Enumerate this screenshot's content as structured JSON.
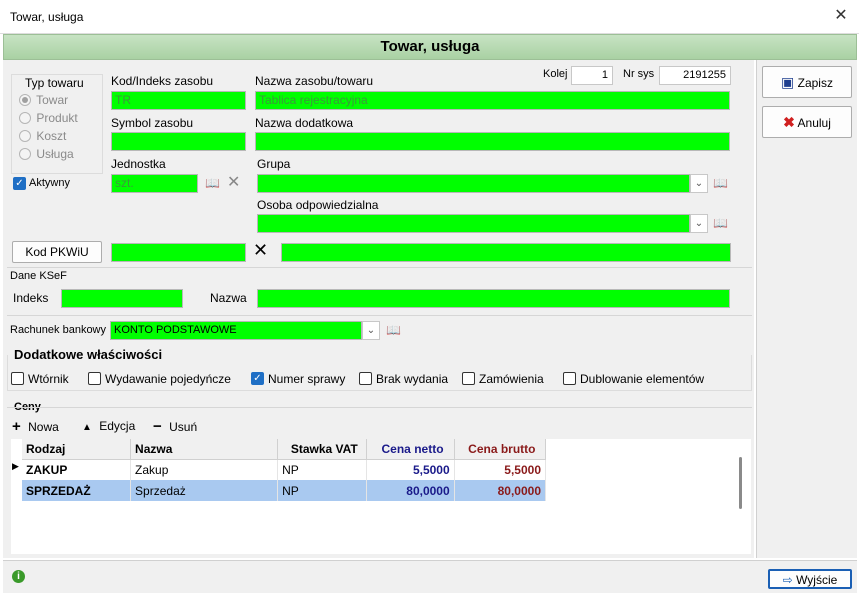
{
  "window": {
    "title": "Towar, usługa",
    "close_glyph": "✕"
  },
  "banner": {
    "title": "Towar, usługa"
  },
  "type_group": {
    "label": "Typ towaru",
    "options": [
      {
        "label": "Towar",
        "selected": true
      },
      {
        "label": "Produkt",
        "selected": false
      },
      {
        "label": "Koszt",
        "selected": false
      },
      {
        "label": "Usługa",
        "selected": false
      }
    ]
  },
  "active": {
    "label": "Aktywny",
    "checked": true
  },
  "fields": {
    "kod_label": "Kod/Indeks zasobu",
    "kod_value": "TR",
    "nazwa_label": "Nazwa zasobu/towaru",
    "nazwa_value": "Tablica rejestracyjna",
    "symbol_label": "Symbol zasobu",
    "symbol_value": "",
    "nazwa_dod_label": "Nazwa dodatkowa",
    "nazwa_dod_value": "",
    "jednostka_label": "Jednostka",
    "jednostka_value": "szt.",
    "grupa_label": "Grupa",
    "grupa_value": "",
    "osoba_label": "Osoba odpowiedzialna",
    "osoba_value": "",
    "kolej_label": "Kolej",
    "kolej_value": "1",
    "nrsys_label": "Nr sys",
    "nrsys_value": "2191255"
  },
  "pkwiu": {
    "button": "Kod PKWiU",
    "code": "",
    "desc": ""
  },
  "ksef": {
    "label": "Dane KSeF",
    "indeks_label": "Indeks",
    "indeks_value": "",
    "nazwa_label": "Nazwa",
    "nazwa_value": ""
  },
  "bank": {
    "label": "Rachunek bankowy",
    "value": "KONTO PODSTAWOWE"
  },
  "extra": {
    "label": "Dodatkowe właściwości",
    "items": [
      {
        "label": "Wtórnik",
        "checked": false
      },
      {
        "label": "Wydawanie pojedyńcze",
        "checked": false
      },
      {
        "label": "Numer sprawy",
        "checked": true
      },
      {
        "label": "Brak wydania",
        "checked": false
      },
      {
        "label": "Zamówienia",
        "checked": false
      },
      {
        "label": "Dublowanie elementów",
        "checked": false
      }
    ]
  },
  "prices": {
    "label": "Ceny",
    "toolbar": {
      "new": "Nowa",
      "edit": "Edycja",
      "delete": "Usuń"
    },
    "columns": [
      "Rodzaj",
      "Nazwa",
      "Stawka VAT",
      "Cena netto",
      "Cena brutto"
    ],
    "rows": [
      {
        "rodzaj": "ZAKUP",
        "nazwa": "Zakup",
        "vat": "NP",
        "netto": "5,5000",
        "brutto": "5,5000"
      },
      {
        "rodzaj": "SPRZEDAŻ",
        "nazwa": "Sprzedaż",
        "vat": "NP",
        "netto": "80,0000",
        "brutto": "80,0000"
      }
    ]
  },
  "side": {
    "save": "Zapisz",
    "cancel": "Anuluj"
  },
  "footer": {
    "exit": "Wyjście"
  },
  "colors": {
    "field_green": "#00ff00",
    "banner": "#b5dab0",
    "selected_row": "#a9c9f0",
    "netto": "#1a1a8a",
    "brutto": "#8a1a1a"
  }
}
